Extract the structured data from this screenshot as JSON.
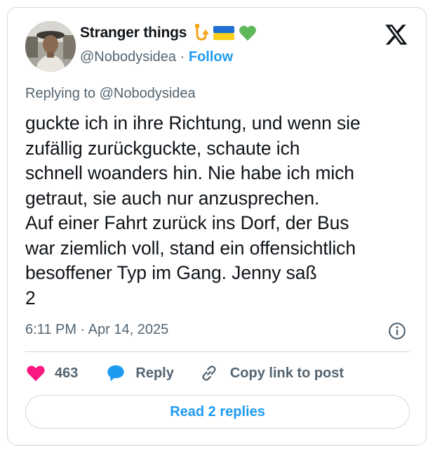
{
  "author": {
    "display_name": "Stranger things",
    "emojis": [
      "🪝",
      "🇺🇦",
      "💚"
    ],
    "handle": "@Nobodysidea",
    "separator": "·",
    "follow_label": "Follow"
  },
  "reply_context": {
    "prefix": "Replying to ",
    "mention": "@Nobodysidea"
  },
  "tweet": {
    "text": "guckte ich in ihre Richtung, und wenn sie\nzufällig zurückguckte, schaute ich\nschnell woanders hin. Nie habe ich mich\ngetraut, sie auch nur anzusprechen.\nAuf einer Fahrt zurück ins Dorf, der Bus\nwar ziemlich voll, stand ein offensichtlich\nbesoffener Typ im Gang. Jenny saß\n2",
    "timestamp": "6:11 PM · Apr 14, 2025"
  },
  "actions": {
    "likes_count": "463",
    "reply_label": "Reply",
    "copy_label": "Copy link to post"
  },
  "read_replies_label": "Read 2 replies",
  "colors": {
    "accent": "#1d9bf0",
    "like": "#f91880",
    "muted": "#536471",
    "border": "#cfd9de"
  },
  "icons": [
    "x-logo-icon",
    "info-icon",
    "heart-icon",
    "reply-bubble-icon",
    "link-icon"
  ]
}
